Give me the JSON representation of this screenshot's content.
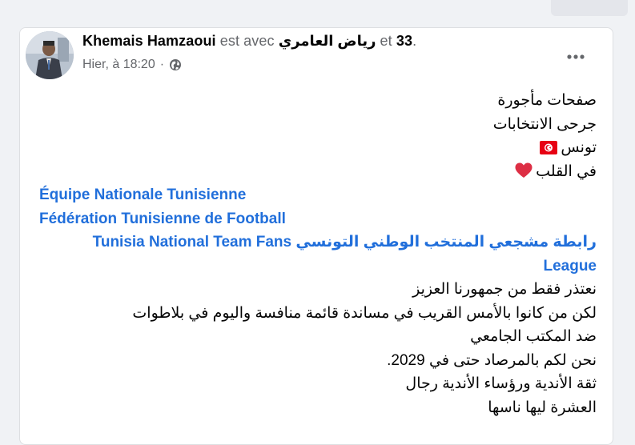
{
  "post": {
    "author": "Khemais Hamzaoui",
    "with_text": "est avec",
    "tagged_name": "رياض العامري",
    "and_text": "et",
    "others_count": "33",
    "suffix": ".",
    "timestamp": "Hier, à 18:20",
    "separator": "·",
    "privacy_icon": "globe-icon",
    "more_icon": "more-options-icon"
  },
  "content": {
    "line1": "صفحات مأجورة",
    "line2": "جرحى الانتخابات",
    "line3": "تونس",
    "line3_emoji": "tunisia-flag-icon",
    "line4": "في القلب",
    "line4_emoji": "red-heart-icon",
    "tag1": "Équipe Nationale Tunisienne",
    "tag2": "Fédération Tunisienne de Football",
    "tag3_line1": "رابطة مشجعي المنتخب الوطني التونسي Tunisia National Team Fans",
    "tag3_line2": "League",
    "line8": "نعتذر فقط من جمهورنا العزيز",
    "line9": "لكن من كانوا بالأمس القريب في  مساندة قائمة منافسة واليوم في بلاطوات",
    "line10": "ضد المكتب الجامعي",
    "line11": "نحن لكم بالمرصاد حتى في 2029.",
    "line12": "ثقة الأندية ورؤساء  الأندية رجال",
    "line13": "العشرة ليها ناسها"
  },
  "colors": {
    "link": "#216fdb",
    "flag_red": "#e70013",
    "heart_red": "#dd2e44"
  }
}
